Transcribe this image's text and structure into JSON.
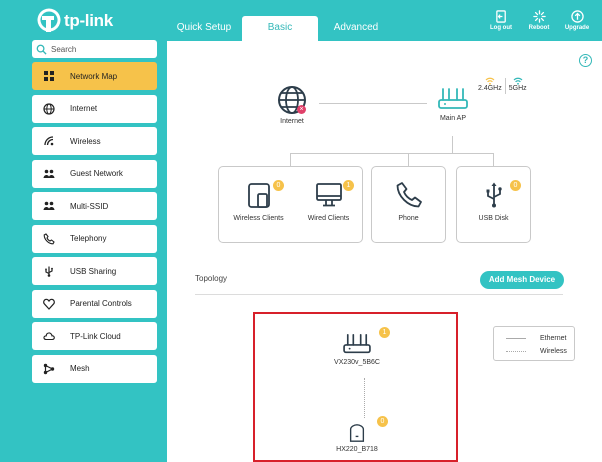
{
  "brand": {
    "name": "tp-link"
  },
  "tabs": [
    {
      "label": "Quick Setup"
    },
    {
      "label": "Basic",
      "active": true
    },
    {
      "label": "Advanced"
    }
  ],
  "header_actions": [
    {
      "label": "Log out",
      "icon": "logout-icon"
    },
    {
      "label": "Reboot",
      "icon": "reboot-icon"
    },
    {
      "label": "Upgrade",
      "icon": "upgrade-icon"
    }
  ],
  "search": {
    "placeholder": "Search",
    "value": ""
  },
  "sidebar": {
    "items": [
      {
        "label": "Network Map",
        "icon": "network-map-icon",
        "active": true
      },
      {
        "label": "Internet",
        "icon": "globe-icon"
      },
      {
        "label": "Wireless",
        "icon": "wireless-icon"
      },
      {
        "label": "Guest Network",
        "icon": "guest-network-icon"
      },
      {
        "label": "Multi-SSID",
        "icon": "multi-ssid-icon"
      },
      {
        "label": "Telephony",
        "icon": "phone-icon"
      },
      {
        "label": "USB Sharing",
        "icon": "usb-icon"
      },
      {
        "label": "Parental Controls",
        "icon": "parental-controls-icon"
      },
      {
        "label": "TP-Link Cloud",
        "icon": "cloud-icon"
      },
      {
        "label": "Mesh",
        "icon": "mesh-icon"
      }
    ]
  },
  "network_map": {
    "internet_label": "Internet",
    "main_ap_label": "Main AP",
    "bands": [
      "2.4GHz",
      "5GHz"
    ],
    "cards": {
      "clients": {
        "wireless": {
          "label": "Wireless Clients",
          "count": "0"
        },
        "wired": {
          "label": "Wired Clients",
          "count": "1"
        }
      },
      "phone": {
        "label": "Phone"
      },
      "usb": {
        "label": "USB Disk",
        "count": "0"
      }
    }
  },
  "topology": {
    "title": "Topology",
    "add_button": "Add Mesh Device",
    "main_device": {
      "name": "VX230v_5B6C",
      "count": "1"
    },
    "satellite": {
      "name": "HX220_B718",
      "count": "0"
    },
    "legend": {
      "ethernet": "Ethernet",
      "wireless": "Wireless"
    }
  },
  "colors": {
    "accent": "#33c3c3",
    "active_item": "#f6c24a",
    "badge": "#f6c24a",
    "alert": "#e0416a",
    "highlight": "#d7202a"
  }
}
